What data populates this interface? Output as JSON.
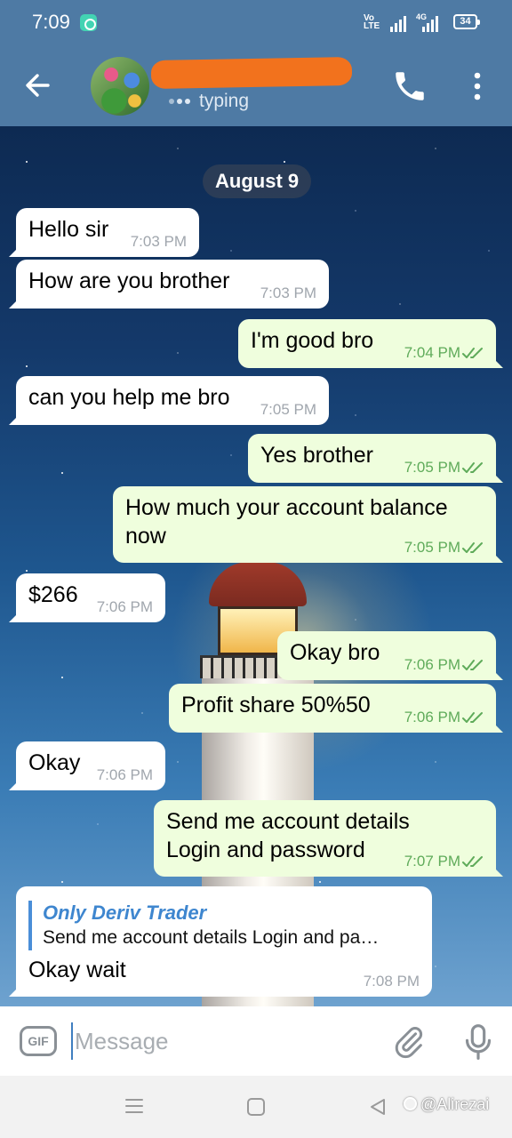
{
  "status_bar": {
    "time": "7:09",
    "volte_line1": "Vo",
    "volte_line2": "LTE",
    "network_type": "4G",
    "battery_level": "34"
  },
  "header": {
    "typing_status": "typing"
  },
  "chat": {
    "date_chip": "August 9",
    "messages": [
      {
        "direction": "in",
        "text": "Hello sir",
        "time": "7:03 PM"
      },
      {
        "direction": "in",
        "text": "How are you brother",
        "time": "7:03 PM"
      },
      {
        "direction": "out",
        "text": "I'm good bro",
        "time": "7:04 PM",
        "status": "read"
      },
      {
        "direction": "in",
        "text": "can you help me bro",
        "time": "7:05 PM"
      },
      {
        "direction": "out",
        "text": "Yes brother",
        "time": "7:05 PM",
        "status": "read"
      },
      {
        "direction": "out",
        "text_line1": "How much your account balance",
        "text_line2": "now",
        "time": "7:05 PM",
        "status": "read"
      },
      {
        "direction": "in",
        "text": "$266",
        "time": "7:06 PM"
      },
      {
        "direction": "out",
        "text": "Okay bro",
        "time": "7:06 PM",
        "status": "read"
      },
      {
        "direction": "out",
        "text": "Profit share 50%50",
        "time": "7:06 PM",
        "status": "read"
      },
      {
        "direction": "in",
        "text": "Okay",
        "time": "7:06 PM"
      },
      {
        "direction": "out",
        "text_line1": "Send me account details",
        "text_line2": "Login and password",
        "time": "7:07 PM",
        "status": "read"
      },
      {
        "direction": "in",
        "reply_author": "Only Deriv Trader",
        "reply_text": "Send me account details Login and pa…",
        "text": "Okay wait",
        "time": "7:08 PM"
      }
    ]
  },
  "input_bar": {
    "gif_label": "GIF",
    "placeholder": "Message"
  },
  "watermark": {
    "text": "@Alirezai"
  },
  "colors": {
    "header": "#4e7aa4",
    "incoming_bubble": "#ffffff",
    "outgoing_bubble": "#effedd",
    "outgoing_time": "#5fab5a",
    "reply_accent": "#3e86cf"
  },
  "icons": {
    "back": "arrow-left-icon",
    "call": "phone-icon",
    "menu": "more-vertical-icon",
    "attach": "paperclip-icon",
    "mic": "microphone-icon",
    "read": "double-check-icon"
  }
}
